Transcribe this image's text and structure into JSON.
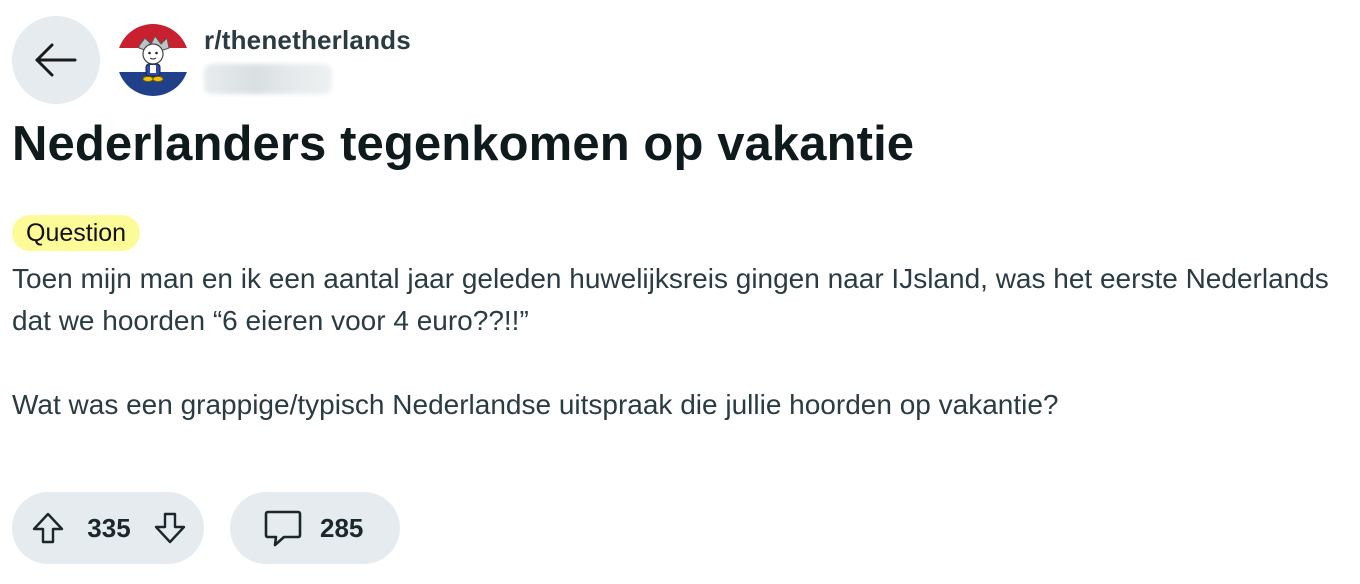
{
  "header": {
    "back_icon": "arrow-left-icon",
    "subreddit": "r/thenetherlands",
    "avatar_icon": "subreddit-avatar-dutch-flag",
    "avatar_colors": {
      "red": "#c8202e",
      "white": "#ffffff",
      "blue": "#20418a"
    }
  },
  "post": {
    "title": "Nederlanders tegenkomen op vakantie",
    "flair": "Question",
    "flair_color": "#fdfb98",
    "body": [
      "Toen mijn man en ik een aantal jaar geleden huwelijksreis gingen naar IJsland, was het eerste Nederlands dat we hoorden “6 eieren voor 4 euro??!!”",
      "Wat was een grappige/typisch Nederlandse uitspraak die jullie hoorden op vakantie?"
    ]
  },
  "actions": {
    "upvote_icon": "upvote-arrow-icon",
    "downvote_icon": "downvote-arrow-icon",
    "vote_count": "335",
    "comment_icon": "comment-bubble-icon",
    "comment_count": "285"
  }
}
